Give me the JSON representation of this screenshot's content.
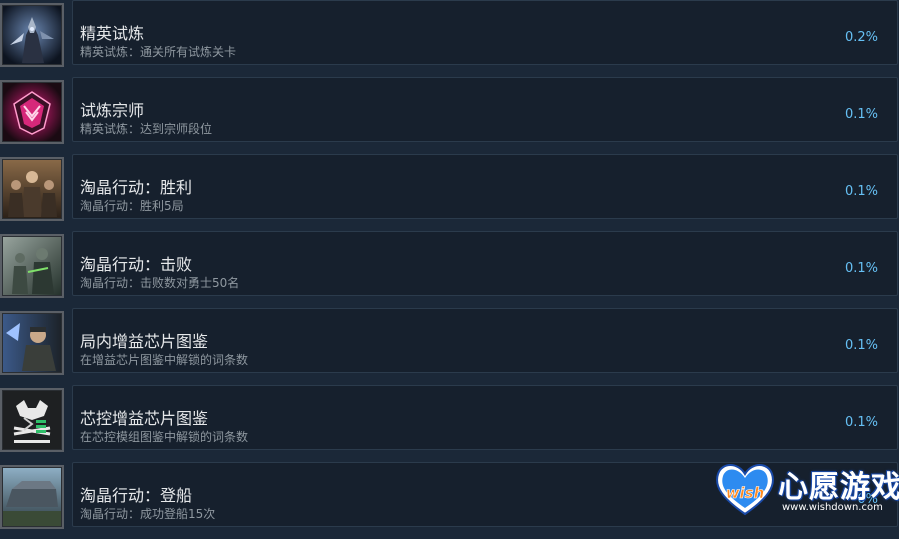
{
  "achievements": [
    {
      "title": "精英试炼",
      "description": "精英试炼：通关所有试炼关卡",
      "percent": "0.2%",
      "icon": "armored-knight-icon"
    },
    {
      "title": "试炼宗师",
      "description": "精英试炼：达到宗师段位",
      "percent": "0.1%",
      "icon": "pink-rank-emblem-icon"
    },
    {
      "title": "淘晶行动：胜利",
      "description": "淘晶行动：胜利5局",
      "percent": "0.1%",
      "icon": "squad-victory-icon"
    },
    {
      "title": "淘晶行动：击败",
      "description": "淘晶行动：击败数对勇士50名",
      "percent": "0.1%",
      "icon": "soldiers-battle-icon"
    },
    {
      "title": "局内增益芯片图鉴",
      "description": "在增益芯片图鉴中解锁的词条数",
      "percent": "0.1%",
      "icon": "soldier-portrait-icon"
    },
    {
      "title": "芯控增益芯片图鉴",
      "description": "在芯控模组图鉴中解锁的词条数",
      "percent": "0.1%",
      "icon": "chip-emblem-icon"
    },
    {
      "title": "淘晶行动：登船",
      "description": "淘晶行动：成功登船15次",
      "percent": "0%",
      "icon": "ship-icon"
    }
  ],
  "watermark": {
    "brand": "心愿游戏",
    "logo_text": "wish",
    "url": "www.wishdown.com"
  },
  "colors": {
    "background": "#1b2838",
    "panel": "#16202d",
    "percent": "#66c0f4"
  }
}
